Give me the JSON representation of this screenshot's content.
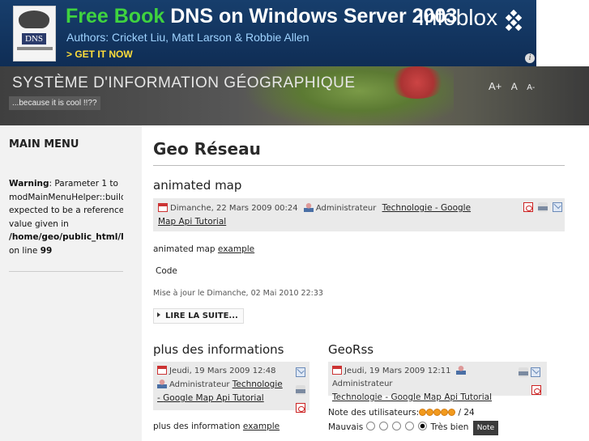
{
  "ad": {
    "title_free": "Free Book",
    "title_rest": "DNS on Windows Server 2003",
    "authors": "Authors: Cricket Liu, Matt Larson & Robbie Allen",
    "cta": "> GET IT NOW",
    "brand": "Infoblox",
    "book_label": "DNS",
    "info": "i",
    "colors": {
      "background": "#173e6c",
      "free": "#3fd33f",
      "authors": "#9fd3ff",
      "cta": "#ffde3a"
    }
  },
  "header": {
    "site_name": "SYSTÈME D'INFORMATION GÉOGRAPHIQUE",
    "slogan": "...because it is cool !!??",
    "font_size_controls": [
      "A+",
      "A",
      "A-"
    ]
  },
  "sidebar": {
    "title": "MAIN MENU",
    "warning_label": "Warning",
    "warning_lines": [
      ": Parameter 1 to",
      "modMainMenuHelper::buildXml()",
      "expected to be a reference,",
      "value given in"
    ],
    "warning_path": "/home/geo/public_html/libraries/joomla/cache/handler/callback.php",
    "warning_online": "on line",
    "warning_line_number": "99"
  },
  "main": {
    "page_title": "Geo Réseau",
    "articles": [
      {
        "title": "animated map",
        "date": "Dimanche, 22 Mars 2009 00:24",
        "author": "Administrateur",
        "category": "Technologie",
        "sep": " - ",
        "section": "Google Map Api Tutorial",
        "body_text": "animated map ",
        "body_link": "example",
        "code_label": "Code",
        "modified": "Mise à jour le Dimanche, 02 Mai 2010 22:33",
        "readmore": "LIRE LA SUITE..."
      },
      {
        "title": "plus des informations",
        "date": "Jeudi, 19 Mars 2009 12:48",
        "author": "Administrateur",
        "category": "Technologie",
        "sep": " - ",
        "section": "Google Map Api Tutorial",
        "body_text": "plus des information ",
        "body_link": "example"
      },
      {
        "title": "GeoRss",
        "date": "Jeudi, 19 Mars 2009 12:11",
        "author": "Administrateur",
        "category": "Technologie",
        "sep": " - ",
        "section": "Google Map Api Tutorial",
        "rating_label": "Note des utilisateurs:",
        "rating_stars": 5,
        "rating_count": "/ 24",
        "vote_low": "Mauvais",
        "vote_high": "Très bien",
        "vote_options": 5,
        "vote_selected": 5,
        "vote_button": "Note"
      }
    ]
  }
}
